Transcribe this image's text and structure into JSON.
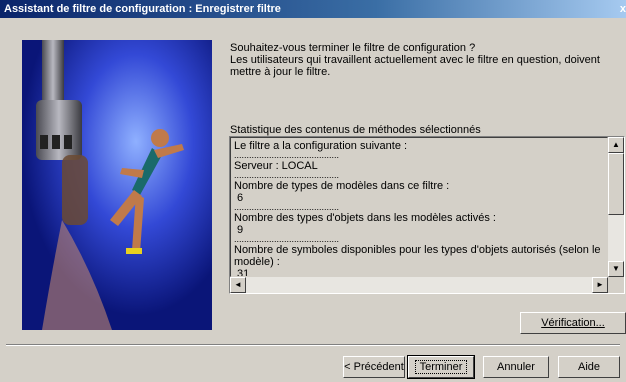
{
  "window": {
    "title": "Assistant de filtre de configuration : Enregistrer filtre",
    "close_glyph": "x"
  },
  "intro": {
    "question": "Souhaitez-vous terminer le filtre de configuration ?",
    "note": "Les utilisateurs qui travaillent actuellement avec le filtre en question, doivent mettre à jour le filtre."
  },
  "statistics": {
    "label": "Statistique des contenus de méthodes sélectionnés",
    "separator": "..........................................",
    "lines": [
      "Le filtre a la configuration suivante :",
      "Serveur : LOCAL",
      "Nombre de types de modèles dans ce filtre :",
      " 6",
      "Nombre des types d'objets dans les modèles activés :",
      " 9",
      "Nombre de symboles disponibles pour les types d'objets autorisés (selon le modèle) :",
      " 31"
    ]
  },
  "buttons": {
    "verification": "Vérification...",
    "previous": "Précédent",
    "previous_prefix": "< ",
    "finish": "Terminer",
    "cancel": "Annuler",
    "help": "Aide"
  },
  "icons": {
    "scroll_up": "scroll-up-icon",
    "scroll_down": "scroll-down-icon",
    "scroll_left": "scroll-left-icon",
    "scroll_right": "scroll-right-icon"
  }
}
